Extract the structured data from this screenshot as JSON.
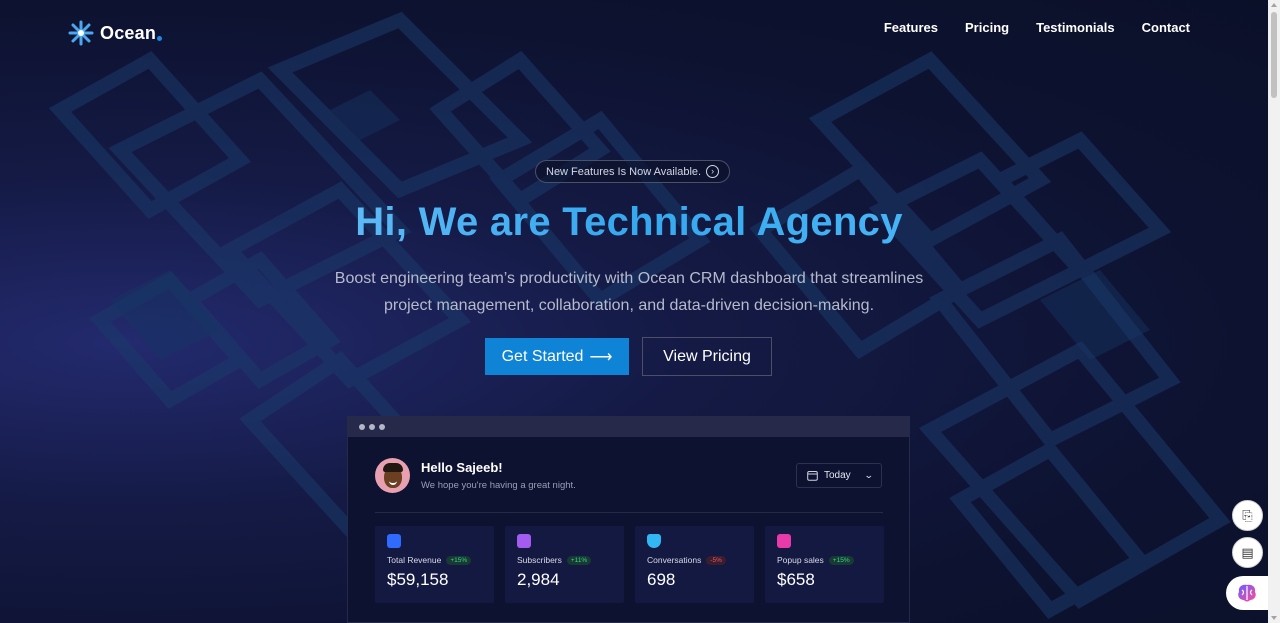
{
  "brand": {
    "name": "Ocean",
    "accent": "#1e88e5"
  },
  "nav": {
    "items": [
      "Features",
      "Pricing",
      "Testimonials",
      "Contact"
    ]
  },
  "hero": {
    "badge": "New Features Is Now Available.",
    "title": "Hi, We are Technical Agency",
    "subtitle_line1": "Boost engineering team’s productivity with Ocean CRM dashboard that streamlines",
    "subtitle_line2": "project management, collaboration, and data-driven decision-making.",
    "primary_cta": "Get Started",
    "primary_cta_arrow": "⟶",
    "secondary_cta": "View Pricing"
  },
  "dashboard": {
    "greeting": "Hello Sajeeb!",
    "greeting_sub": "We hope you're having a great night.",
    "period": "Today",
    "stats": [
      {
        "label": "Total Revenue",
        "change": "+15%",
        "trend": "up",
        "value": "$59,158",
        "icon": "chart-icon",
        "color": "#2f6bff"
      },
      {
        "label": "Subscribers",
        "change": "+11%",
        "trend": "up",
        "value": "2,984",
        "icon": "document-icon",
        "color": "#a45cf0"
      },
      {
        "label": "Conversations",
        "change": "-5%",
        "trend": "down",
        "value": "698",
        "icon": "shield-icon",
        "color": "#33b7f2"
      },
      {
        "label": "Popup sales",
        "change": "+15%",
        "trend": "up",
        "value": "$658",
        "icon": "bar-chart-icon",
        "color": "#e83aa8"
      }
    ]
  },
  "colors": {
    "primary_button": "#0f83d6",
    "title_gradient_start": "#8fd0ff",
    "title_gradient_end": "#35a8ee"
  }
}
